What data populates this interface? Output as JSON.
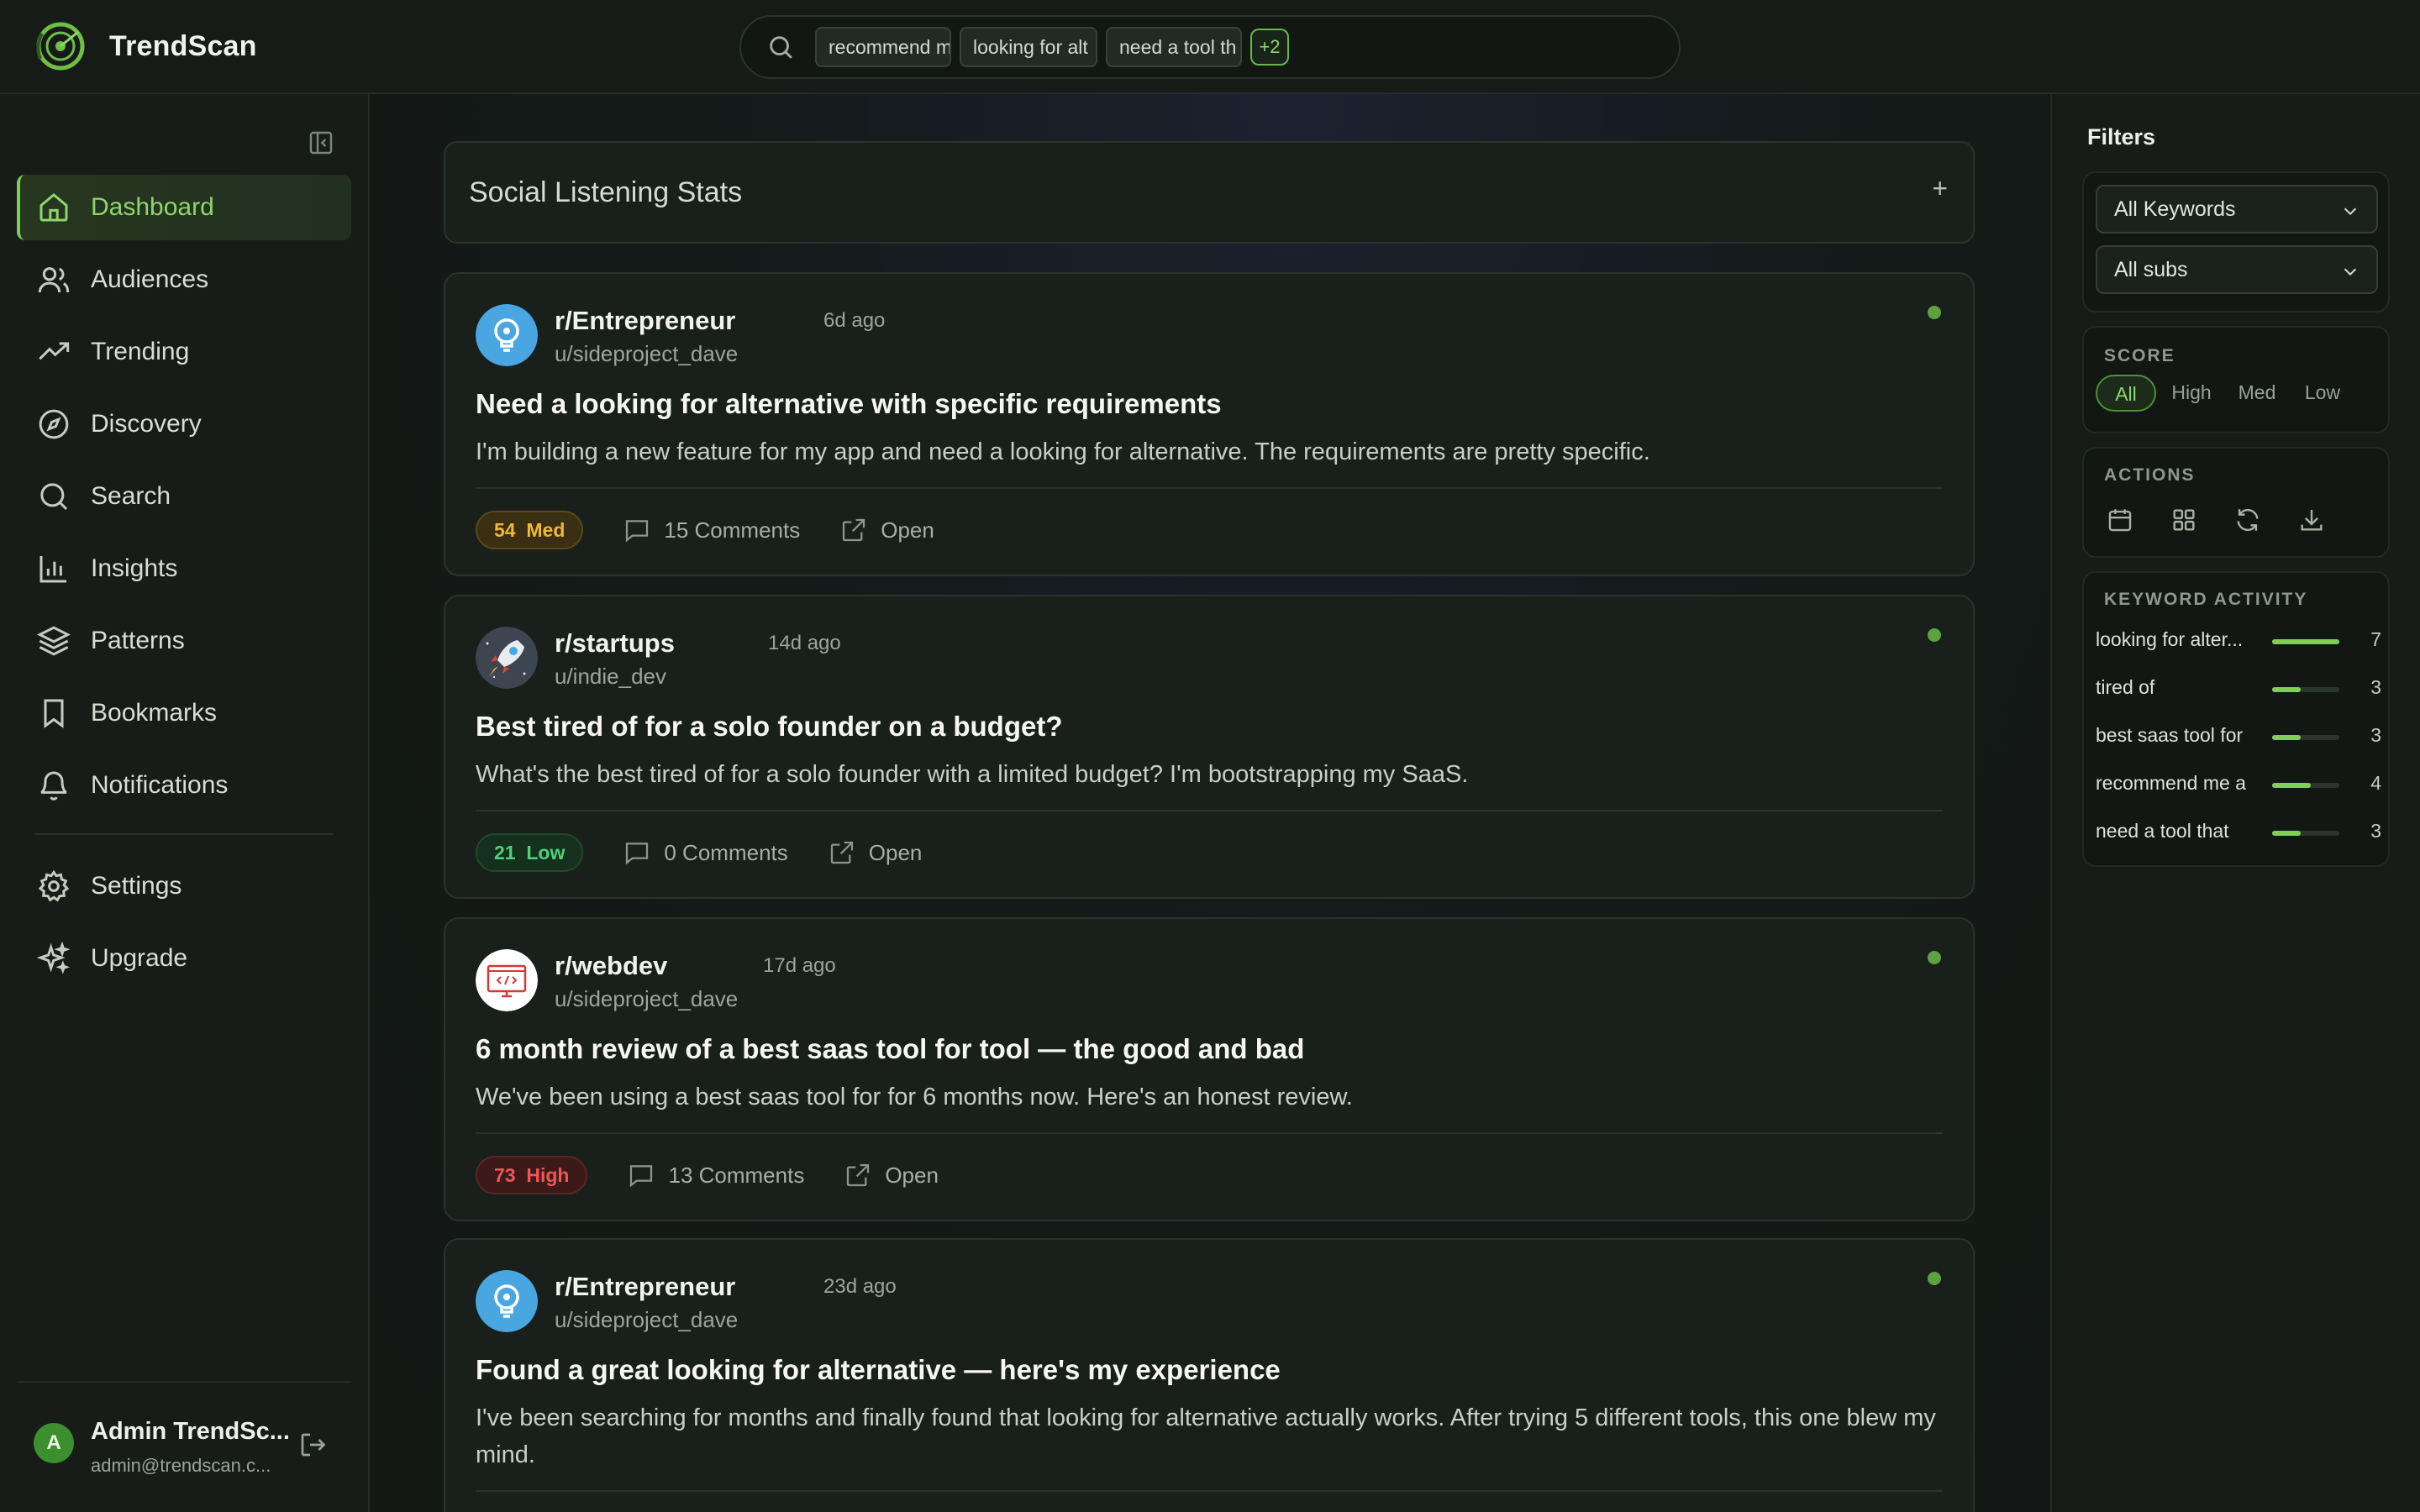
{
  "app": {
    "name": "TrendScan"
  },
  "search": {
    "chips": [
      "recommend m",
      "looking for alt",
      "need a tool th"
    ],
    "more": "+2"
  },
  "sidebar": {
    "items": [
      {
        "label": "Dashboard",
        "icon": "home-icon"
      },
      {
        "label": "Audiences",
        "icon": "users-icon"
      },
      {
        "label": "Trending",
        "icon": "trending-icon"
      },
      {
        "label": "Discovery",
        "icon": "compass-icon"
      },
      {
        "label": "Search",
        "icon": "search-icon"
      },
      {
        "label": "Insights",
        "icon": "bar-chart-icon"
      },
      {
        "label": "Patterns",
        "icon": "layers-icon"
      },
      {
        "label": "Bookmarks",
        "icon": "bookmark-icon"
      },
      {
        "label": "Notifications",
        "icon": "bell-icon"
      }
    ],
    "bottom_items": [
      {
        "label": "Settings",
        "icon": "gear-icon"
      },
      {
        "label": "Upgrade",
        "icon": "sparkles-icon"
      }
    ],
    "active": "Dashboard",
    "user": {
      "initial": "A",
      "name": "Admin TrendSc...",
      "email": "admin@trendscan.c..."
    }
  },
  "stats": {
    "title": "Social Listening Stats",
    "toggle": "+"
  },
  "posts": [
    {
      "subreddit": "r/Entrepreneur",
      "ago": "6d ago",
      "author": "u/sideproject_dave",
      "title": "Need a looking for alternative with specific requirements",
      "body": "I'm building a new feature for my app and need a looking for alternative. The requirements are pretty specific.",
      "score": "54",
      "score_label": "Med",
      "comments": "15 Comments",
      "open": "Open"
    },
    {
      "subreddit": "r/startups",
      "ago": "14d ago",
      "author": "u/indie_dev",
      "title": "Best tired of for a solo founder on a budget?",
      "body": "What's the best tired of for a solo founder with a limited budget? I'm bootstrapping my SaaS.",
      "score": "21",
      "score_label": "Low",
      "comments": "0 Comments",
      "open": "Open"
    },
    {
      "subreddit": "r/webdev",
      "ago": "17d ago",
      "author": "u/sideproject_dave",
      "title": "6 month review of a best saas tool for tool — the good and bad",
      "body": "We've been using a best saas tool for for 6 months now. Here's an honest review.",
      "score": "73",
      "score_label": "High",
      "comments": "13 Comments",
      "open": "Open"
    },
    {
      "subreddit": "r/Entrepreneur",
      "ago": "23d ago",
      "author": "u/sideproject_dave",
      "title": "Found a great looking for alternative — here's my experience",
      "body": "I've been searching for months and finally found that looking for alternative actually works. After trying 5 different tools, this one blew my mind."
    }
  ],
  "filters": {
    "title": "Filters",
    "keyword_select": "All Keywords",
    "sub_select": "All subs",
    "score_label": "SCORE",
    "score_options": [
      "All",
      "High",
      "Med",
      "Low"
    ],
    "score_selected": "All",
    "actions_label": "ACTIONS",
    "actions": [
      "calendar-icon",
      "grid-icon",
      "refresh-icon",
      "download-icon"
    ],
    "activity_label": "KEYWORD ACTIVITY",
    "activity": [
      {
        "keyword": "looking for alter...",
        "count": "7",
        "level": 1.0
      },
      {
        "keyword": "tired of",
        "count": "3",
        "level": 0.43
      },
      {
        "keyword": "best saas tool for",
        "count": "3",
        "level": 0.43
      },
      {
        "keyword": "recommend me a",
        "count": "4",
        "level": 0.57
      },
      {
        "keyword": "need a tool that",
        "count": "3",
        "level": 0.43
      }
    ]
  },
  "colors": {
    "accent": "#7fcf55",
    "med": "#f0b834",
    "low": "#4fd07a",
    "high": "#f05555"
  }
}
